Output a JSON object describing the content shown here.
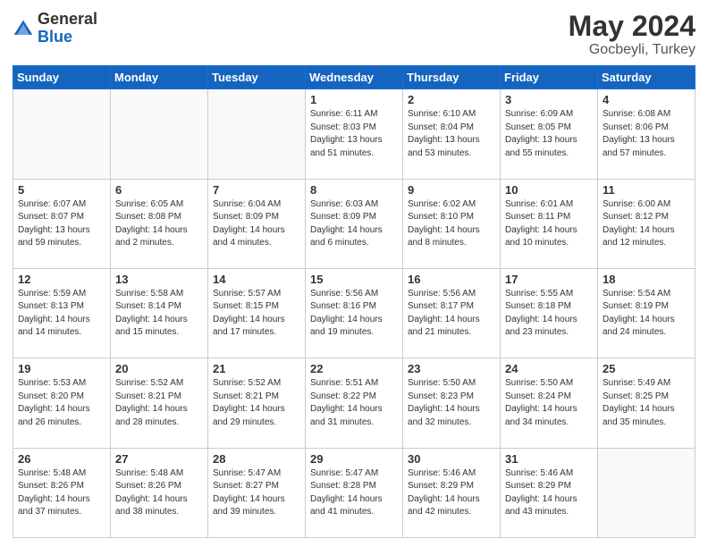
{
  "header": {
    "logo_general": "General",
    "logo_blue": "Blue",
    "month_title": "May 2024",
    "location": "Gocbeyli, Turkey"
  },
  "days_of_week": [
    "Sunday",
    "Monday",
    "Tuesday",
    "Wednesday",
    "Thursday",
    "Friday",
    "Saturday"
  ],
  "weeks": [
    [
      {
        "day": "",
        "info": ""
      },
      {
        "day": "",
        "info": ""
      },
      {
        "day": "",
        "info": ""
      },
      {
        "day": "1",
        "info": "Sunrise: 6:11 AM\nSunset: 8:03 PM\nDaylight: 13 hours\nand 51 minutes."
      },
      {
        "day": "2",
        "info": "Sunrise: 6:10 AM\nSunset: 8:04 PM\nDaylight: 13 hours\nand 53 minutes."
      },
      {
        "day": "3",
        "info": "Sunrise: 6:09 AM\nSunset: 8:05 PM\nDaylight: 13 hours\nand 55 minutes."
      },
      {
        "day": "4",
        "info": "Sunrise: 6:08 AM\nSunset: 8:06 PM\nDaylight: 13 hours\nand 57 minutes."
      }
    ],
    [
      {
        "day": "5",
        "info": "Sunrise: 6:07 AM\nSunset: 8:07 PM\nDaylight: 13 hours\nand 59 minutes."
      },
      {
        "day": "6",
        "info": "Sunrise: 6:05 AM\nSunset: 8:08 PM\nDaylight: 14 hours\nand 2 minutes."
      },
      {
        "day": "7",
        "info": "Sunrise: 6:04 AM\nSunset: 8:09 PM\nDaylight: 14 hours\nand 4 minutes."
      },
      {
        "day": "8",
        "info": "Sunrise: 6:03 AM\nSunset: 8:09 PM\nDaylight: 14 hours\nand 6 minutes."
      },
      {
        "day": "9",
        "info": "Sunrise: 6:02 AM\nSunset: 8:10 PM\nDaylight: 14 hours\nand 8 minutes."
      },
      {
        "day": "10",
        "info": "Sunrise: 6:01 AM\nSunset: 8:11 PM\nDaylight: 14 hours\nand 10 minutes."
      },
      {
        "day": "11",
        "info": "Sunrise: 6:00 AM\nSunset: 8:12 PM\nDaylight: 14 hours\nand 12 minutes."
      }
    ],
    [
      {
        "day": "12",
        "info": "Sunrise: 5:59 AM\nSunset: 8:13 PM\nDaylight: 14 hours\nand 14 minutes."
      },
      {
        "day": "13",
        "info": "Sunrise: 5:58 AM\nSunset: 8:14 PM\nDaylight: 14 hours\nand 15 minutes."
      },
      {
        "day": "14",
        "info": "Sunrise: 5:57 AM\nSunset: 8:15 PM\nDaylight: 14 hours\nand 17 minutes."
      },
      {
        "day": "15",
        "info": "Sunrise: 5:56 AM\nSunset: 8:16 PM\nDaylight: 14 hours\nand 19 minutes."
      },
      {
        "day": "16",
        "info": "Sunrise: 5:56 AM\nSunset: 8:17 PM\nDaylight: 14 hours\nand 21 minutes."
      },
      {
        "day": "17",
        "info": "Sunrise: 5:55 AM\nSunset: 8:18 PM\nDaylight: 14 hours\nand 23 minutes."
      },
      {
        "day": "18",
        "info": "Sunrise: 5:54 AM\nSunset: 8:19 PM\nDaylight: 14 hours\nand 24 minutes."
      }
    ],
    [
      {
        "day": "19",
        "info": "Sunrise: 5:53 AM\nSunset: 8:20 PM\nDaylight: 14 hours\nand 26 minutes."
      },
      {
        "day": "20",
        "info": "Sunrise: 5:52 AM\nSunset: 8:21 PM\nDaylight: 14 hours\nand 28 minutes."
      },
      {
        "day": "21",
        "info": "Sunrise: 5:52 AM\nSunset: 8:21 PM\nDaylight: 14 hours\nand 29 minutes."
      },
      {
        "day": "22",
        "info": "Sunrise: 5:51 AM\nSunset: 8:22 PM\nDaylight: 14 hours\nand 31 minutes."
      },
      {
        "day": "23",
        "info": "Sunrise: 5:50 AM\nSunset: 8:23 PM\nDaylight: 14 hours\nand 32 minutes."
      },
      {
        "day": "24",
        "info": "Sunrise: 5:50 AM\nSunset: 8:24 PM\nDaylight: 14 hours\nand 34 minutes."
      },
      {
        "day": "25",
        "info": "Sunrise: 5:49 AM\nSunset: 8:25 PM\nDaylight: 14 hours\nand 35 minutes."
      }
    ],
    [
      {
        "day": "26",
        "info": "Sunrise: 5:48 AM\nSunset: 8:26 PM\nDaylight: 14 hours\nand 37 minutes."
      },
      {
        "day": "27",
        "info": "Sunrise: 5:48 AM\nSunset: 8:26 PM\nDaylight: 14 hours\nand 38 minutes."
      },
      {
        "day": "28",
        "info": "Sunrise: 5:47 AM\nSunset: 8:27 PM\nDaylight: 14 hours\nand 39 minutes."
      },
      {
        "day": "29",
        "info": "Sunrise: 5:47 AM\nSunset: 8:28 PM\nDaylight: 14 hours\nand 41 minutes."
      },
      {
        "day": "30",
        "info": "Sunrise: 5:46 AM\nSunset: 8:29 PM\nDaylight: 14 hours\nand 42 minutes."
      },
      {
        "day": "31",
        "info": "Sunrise: 5:46 AM\nSunset: 8:29 PM\nDaylight: 14 hours\nand 43 minutes."
      },
      {
        "day": "",
        "info": ""
      }
    ]
  ]
}
